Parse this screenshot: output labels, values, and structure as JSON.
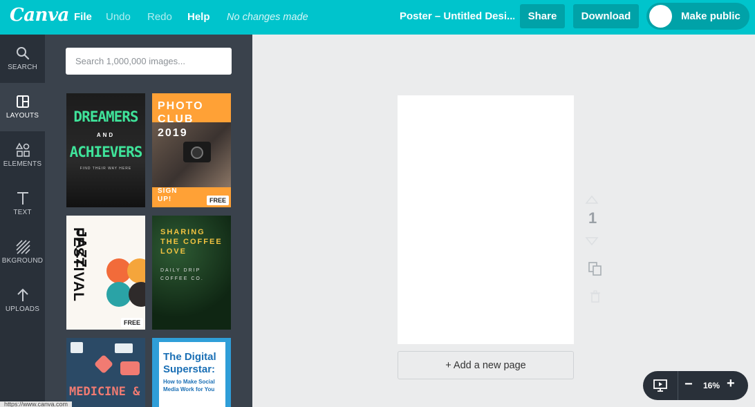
{
  "app": {
    "logo": "Canva",
    "menu": {
      "file": "File",
      "undo": "Undo",
      "redo": "Redo",
      "help": "Help"
    },
    "save_status": "No changes made",
    "doc_title": "Poster – Untitled Desi...",
    "share_label": "Share",
    "download_label": "Download",
    "make_public_label": "Make public",
    "accent_color": "#00c4cc"
  },
  "rail": {
    "items": [
      {
        "label": "SEARCH",
        "icon": "search-icon"
      },
      {
        "label": "LAYOUTS",
        "icon": "layouts-icon",
        "active": true
      },
      {
        "label": "ELEMENTS",
        "icon": "elements-icon"
      },
      {
        "label": "TEXT",
        "icon": "text-icon"
      },
      {
        "label": "BKGROUND",
        "icon": "background-icon"
      },
      {
        "label": "UPLOADS",
        "icon": "upload-icon"
      }
    ]
  },
  "panel": {
    "search_placeholder": "Search 1,000,000 images...",
    "templates": [
      {
        "title": "DREAMERS AND ACHIEVERS",
        "line1": "DREAMERS",
        "line2": "AND",
        "line3": "ACHIEVERS",
        "sub": "FIND THEIR WAY HERE"
      },
      {
        "line1": "PHOTO",
        "line2": "CLUB",
        "line3": "2019",
        "cta": "SIGN UP!",
        "badge": "FREE"
      },
      {
        "line1": "JAZZ",
        "line2": "FESTIVAL",
        "badge": "FREE"
      },
      {
        "line1": "SHARING",
        "line2": "THE COFFEE",
        "line3": "LOVE",
        "sub1": "DAILY DRIP",
        "sub2": "COFFEE CO."
      },
      {
        "line1": "MEDICINE &"
      },
      {
        "line1": "The Digital",
        "line2": "Superstar:",
        "sub1": "How to Make Social",
        "sub2": "Media Work for You"
      }
    ]
  },
  "canvas": {
    "add_page_label": "+ Add a new page",
    "page_number": "1"
  },
  "zoom": {
    "minus": "−",
    "value": "16%",
    "plus": "+"
  },
  "status_bar": {
    "url": "https://www.canva.com"
  }
}
